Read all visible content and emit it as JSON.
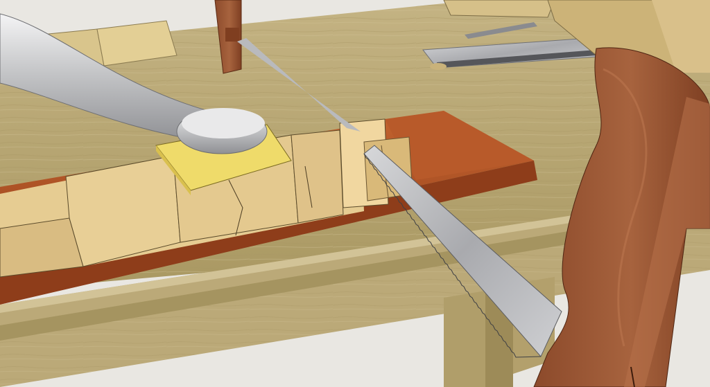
{
  "scene": {
    "colors": {
      "wall": "#e9e7e2",
      "bench": "#b9a878",
      "bench_dark": "#9f8f61",
      "bench_edge": "#c8b888",
      "moulding": "#a8975f",
      "workpiece": "#e4c98f",
      "workpiece_shadow": "#cfb177",
      "mahogany": "#b45a2b",
      "mahogany_dark": "#8f3f1c",
      "holdfast": "#c9c9cb",
      "saw_blade": "#b6b7bb",
      "saw_handle": "#9b5836",
      "pad": "#efdb6a"
    },
    "objects": [
      "workbench",
      "holdfast",
      "dovetail-saw",
      "workpiece",
      "mahogany-board",
      "leather-pad",
      "back-saw",
      "marking-knife"
    ]
  }
}
